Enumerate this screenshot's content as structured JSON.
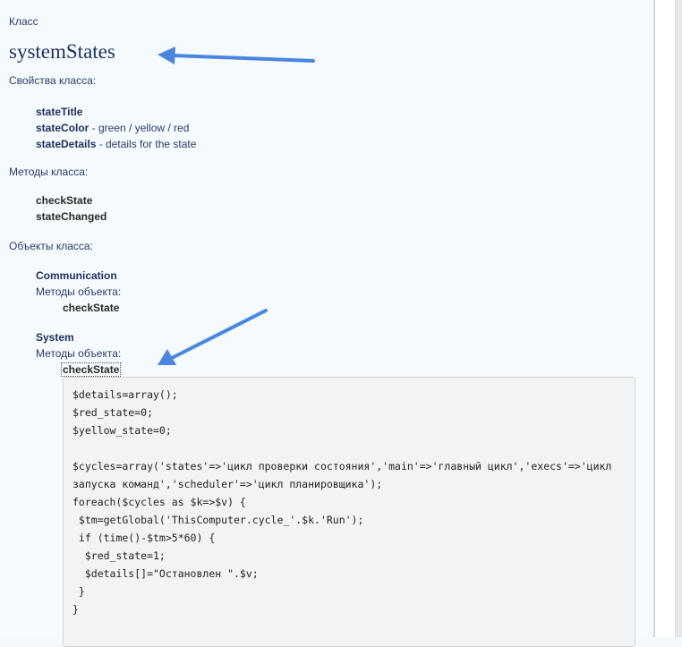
{
  "page": {
    "class_label": "Класс",
    "class_name": "systemStates",
    "properties_label": "Свойства класса:",
    "properties": [
      {
        "name": "stateTitle",
        "desc": ""
      },
      {
        "name": "stateColor",
        "desc": " - green / yellow / red"
      },
      {
        "name": "stateDetails",
        "desc": " - details for the state"
      }
    ],
    "methods_label": "Методы класса:",
    "methods": [
      "checkState",
      "stateChanged"
    ],
    "objects_label": "Объекты класса:",
    "objects": [
      {
        "name": "Communication",
        "methods_label": "Методы объекта:",
        "method": "checkState"
      },
      {
        "name": "System",
        "methods_label": "Методы объекта:",
        "method": "checkState"
      }
    ]
  },
  "code_lines": [
    "$details=array();",
    "$red_state=0;",
    "$yellow_state=0;",
    "",
    "$cycles=array('states'=>'цикл проверки состояния','main'=>'главный цикл','execs'=>'цикл",
    "запуска команд','scheduler'=>'цикл планировщика');",
    "foreach($cycles as $k=>$v) {",
    " $tm=getGlobal('ThisComputer.cycle_'.$k.'Run');",
    " if (time()-$tm>5*60) {",
    "  $red_state=1;",
    "  $details[]=\"Остановлен \".$v;",
    " }",
    "}"
  ],
  "annotation_color": "#4a86e0"
}
